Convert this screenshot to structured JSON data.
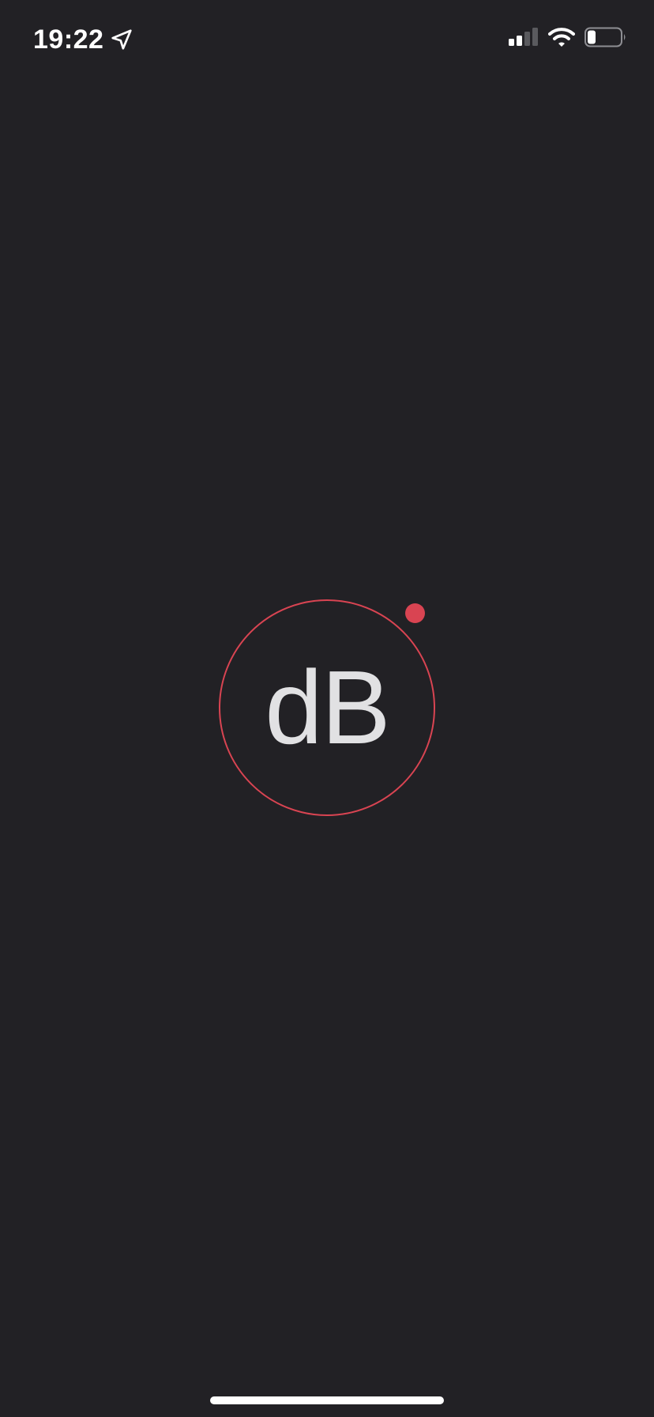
{
  "status_bar": {
    "time": "19:22",
    "location_icon": "location-arrow-icon",
    "signal_icon": "cellular-signal-icon",
    "signal_bars_active": 2,
    "signal_bars_total": 4,
    "wifi_icon": "wifi-icon",
    "battery_icon": "battery-icon",
    "battery_level_fraction": 0.25
  },
  "splash": {
    "logo_text": "dB",
    "indicator_icon": "record-dot-icon"
  },
  "colors": {
    "background": "#222125",
    "accent": "#d94452",
    "logo_text": "#e1e1e3",
    "status_foreground": "#ffffff"
  }
}
